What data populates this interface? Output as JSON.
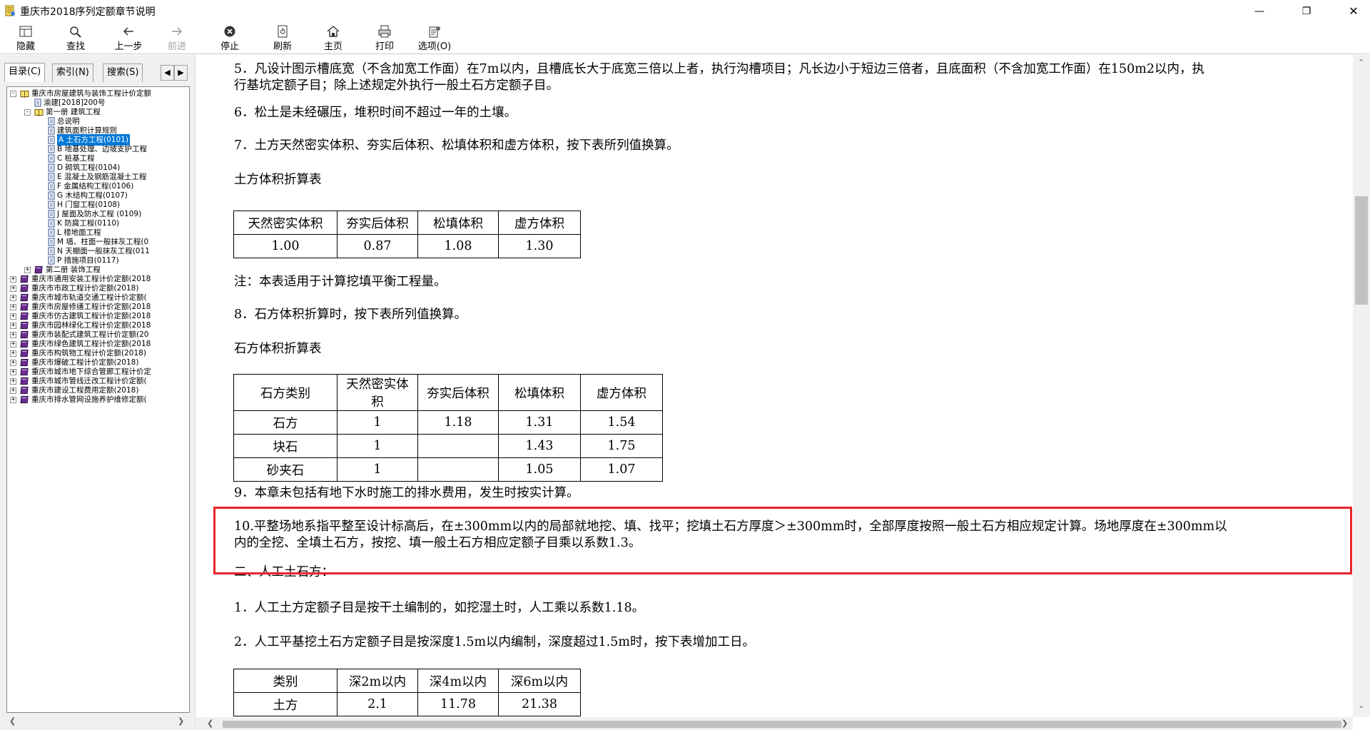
{
  "window": {
    "title": "重庆市2018序列定额章节说明"
  },
  "toolbar": [
    {
      "label": "隐藏",
      "icon": "hide-icon",
      "enabled": true
    },
    {
      "label": "查找",
      "icon": "find-icon",
      "enabled": true
    },
    {
      "label": "上一步",
      "icon": "back-icon",
      "enabled": true
    },
    {
      "label": "前进",
      "icon": "forward-icon",
      "enabled": false
    },
    {
      "label": "停止",
      "icon": "stop-icon",
      "enabled": true
    },
    {
      "label": "刷新",
      "icon": "refresh-icon",
      "enabled": true
    },
    {
      "label": "主页",
      "icon": "home-icon",
      "enabled": true
    },
    {
      "label": "打印",
      "icon": "print-icon",
      "enabled": true
    },
    {
      "label": "选项(O)",
      "icon": "options-icon",
      "enabled": true
    }
  ],
  "tabs": [
    "目录(C)",
    "索引(N)",
    "搜索(S)"
  ],
  "tree": [
    {
      "label": "重庆市房屋建筑与装饰工程计价定额",
      "level": 0,
      "type": "book-open",
      "expander": "-"
    },
    {
      "label": "渝建[2018]200号",
      "level": 1,
      "type": "doc",
      "expander": ""
    },
    {
      "label": "第一册 建筑工程",
      "level": 1,
      "type": "book-open",
      "expander": "-"
    },
    {
      "label": "总说明",
      "level": 2,
      "type": "doc",
      "expander": ""
    },
    {
      "label": "建筑面积计算规则",
      "level": 2,
      "type": "doc",
      "expander": ""
    },
    {
      "label": "A 土石方工程(0101)",
      "level": 2,
      "type": "doc",
      "expander": "",
      "selected": true
    },
    {
      "label": "B 地基处理、边坡支护工程",
      "level": 2,
      "type": "doc",
      "expander": ""
    },
    {
      "label": "C 桩基工程",
      "level": 2,
      "type": "doc",
      "expander": ""
    },
    {
      "label": "D 砌筑工程(0104)",
      "level": 2,
      "type": "doc",
      "expander": ""
    },
    {
      "label": "E 混凝土及钢筋混凝土工程",
      "level": 2,
      "type": "doc",
      "expander": ""
    },
    {
      "label": "F 金属结构工程(0106)",
      "level": 2,
      "type": "doc",
      "expander": ""
    },
    {
      "label": "G 木结构工程(0107)",
      "level": 2,
      "type": "doc",
      "expander": ""
    },
    {
      "label": "H 门窗工程(0108)",
      "level": 2,
      "type": "doc",
      "expander": ""
    },
    {
      "label": "J 屋面及防水工程 (0109)",
      "level": 2,
      "type": "doc",
      "expander": ""
    },
    {
      "label": "K 防腐工程(0110)",
      "level": 2,
      "type": "doc",
      "expander": ""
    },
    {
      "label": "L 楼地面工程",
      "level": 2,
      "type": "doc",
      "expander": ""
    },
    {
      "label": "M 墙、柱面一般抹灰工程(0",
      "level": 2,
      "type": "doc",
      "expander": ""
    },
    {
      "label": "N 天棚面一般抹灰工程(011",
      "level": 2,
      "type": "doc",
      "expander": ""
    },
    {
      "label": "P 措施项目(0117)",
      "level": 2,
      "type": "doc",
      "expander": ""
    },
    {
      "label": "第二册 装饰工程",
      "level": 1,
      "type": "book-closed",
      "expander": "+"
    },
    {
      "label": "重庆市通用安装工程计价定额(2018",
      "level": 0,
      "type": "book-closed",
      "expander": "+"
    },
    {
      "label": "重庆市市政工程计价定额(2018)",
      "level": 0,
      "type": "book-closed",
      "expander": "+"
    },
    {
      "label": "重庆市城市轨道交通工程计价定额(",
      "level": 0,
      "type": "book-closed",
      "expander": "+"
    },
    {
      "label": "重庆市房屋修缮工程计价定额(2018",
      "level": 0,
      "type": "book-closed",
      "expander": "+"
    },
    {
      "label": "重庆市仿古建筑工程计价定额(2018",
      "level": 0,
      "type": "book-closed",
      "expander": "+"
    },
    {
      "label": "重庆市园林绿化工程计价定额(2018",
      "level": 0,
      "type": "book-closed",
      "expander": "+"
    },
    {
      "label": "重庆市装配式建筑工程计价定额(20",
      "level": 0,
      "type": "book-closed",
      "expander": "+"
    },
    {
      "label": "重庆市绿色建筑工程计价定额(2018",
      "level": 0,
      "type": "book-closed",
      "expander": "+"
    },
    {
      "label": "重庆市构筑物工程计价定额(2018)",
      "level": 0,
      "type": "book-closed",
      "expander": "+"
    },
    {
      "label": "重庆市爆破工程计价定额(2018)",
      "level": 0,
      "type": "book-closed",
      "expander": "+"
    },
    {
      "label": "重庆市城市地下综合管廊工程计价定",
      "level": 0,
      "type": "book-closed",
      "expander": "+"
    },
    {
      "label": "重庆市城市管线迁改工程计价定额(",
      "level": 0,
      "type": "book-closed",
      "expander": "+"
    },
    {
      "label": "重庆市建设工程费用定额(2018)",
      "level": 0,
      "type": "book-closed",
      "expander": "+"
    },
    {
      "label": "重庆市排水管网设施养护维修定额(",
      "level": 0,
      "type": "book-closed",
      "expander": "+"
    }
  ],
  "content": {
    "p5a": "5．凡设计图示槽底宽（不含加宽工作面）在7m以内，且槽底长大于底宽三倍以上者，执行沟槽项目；凡长边小于短边三倍者，且底面积（不含加宽工作面）在150m2以内，执",
    "p5b": "行基坑定额子目；除上述规定外执行一般土石方定额子目。",
    "p6": "6．松土是未经碾压，堆积时间不超过一年的土壤。",
    "p7": "7．土方天然密实体积、夯实后体积、松填体积和虚方体积，按下表所列值换算。",
    "t1_title": "土方体积折算表",
    "t1": [
      [
        "天然密实体积",
        "夯实后体积",
        "松填体积",
        "虚方体积"
      ],
      [
        "1.00",
        "0.87",
        "1.08",
        "1.30"
      ]
    ],
    "note": "注：本表适用于计算挖填平衡工程量。",
    "p8": "8．石方体积折算时，按下表所列值换算。",
    "t2_title": "石方体积折算表",
    "t2": [
      [
        "石方类别",
        "天然密实体积",
        "夯实后体积",
        "松填体积",
        "虚方体积"
      ],
      [
        "石方",
        "1",
        "1.18",
        "1.31",
        "1.54"
      ],
      [
        "块石",
        "1",
        "",
        "1.43",
        "1.75"
      ],
      [
        "砂夹石",
        "1",
        "",
        "1.05",
        "1.07"
      ]
    ],
    "p9": "9．本章未包括有地下水时施工的排水费用，发生时按实计算。",
    "p10a": "10.平整场地系指平整至设计标高后，在±300mm以内的局部就地挖、填、找平；挖填土石方厚度＞±300mm时，全部厚度按照一般土石方相应规定计算。场地厚度在±300mm以",
    "p10b": "内的全挖、全填土石方，按挖、填一般土石方相应定额子目乘以系数1.3。",
    "h2": "二、人工土石方：",
    "q1": "1．人工土方定额子目是按干土编制的，如挖湿土时，人工乘以系数1.18。",
    "q2": "2．人工平基挖土石方定额子目是按深度1.5m以内编制，深度超过1.5m时，按下表增加工日。",
    "t3": [
      [
        "类别",
        "深2m以内",
        "深4m以内",
        "深6m以内"
      ],
      [
        "土方",
        "2.1",
        "11.78",
        "21.38"
      ]
    ]
  }
}
